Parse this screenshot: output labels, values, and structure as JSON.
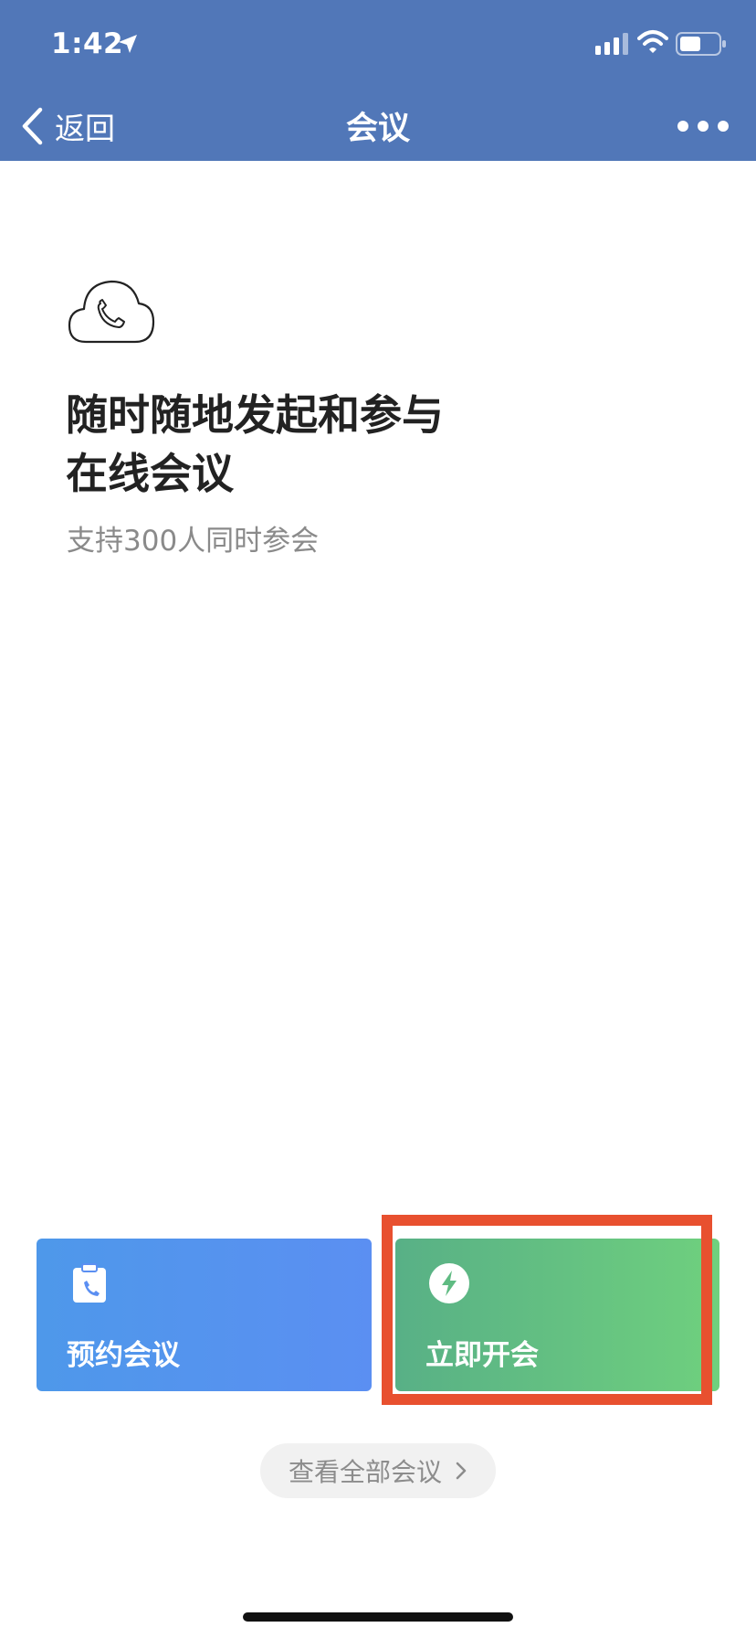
{
  "status_bar": {
    "time": "1:42",
    "icons": [
      "location-arrow-icon",
      "cellular-signal-icon",
      "wifi-icon",
      "battery-icon"
    ]
  },
  "nav": {
    "back_label": "返回",
    "title": "会议",
    "more_icon": "ellipsis-icon"
  },
  "hero": {
    "icon": "cloud-phone-icon",
    "headline_line1": "随时随地发起和参与",
    "headline_line2": "在线会议",
    "subtitle": "支持300人同时参会"
  },
  "actions": {
    "schedule": {
      "label": "预约会议",
      "icon": "clipboard-phone-icon"
    },
    "start_now": {
      "label": "立即开会",
      "icon": "lightning-icon"
    }
  },
  "view_all": {
    "label": "查看全部会议",
    "icon": "chevron-right-icon"
  },
  "colors": {
    "header": "#5177b8",
    "schedule_card": "#5b8ff2",
    "start_card": "#6fd07e",
    "highlight": "#e8502f"
  }
}
